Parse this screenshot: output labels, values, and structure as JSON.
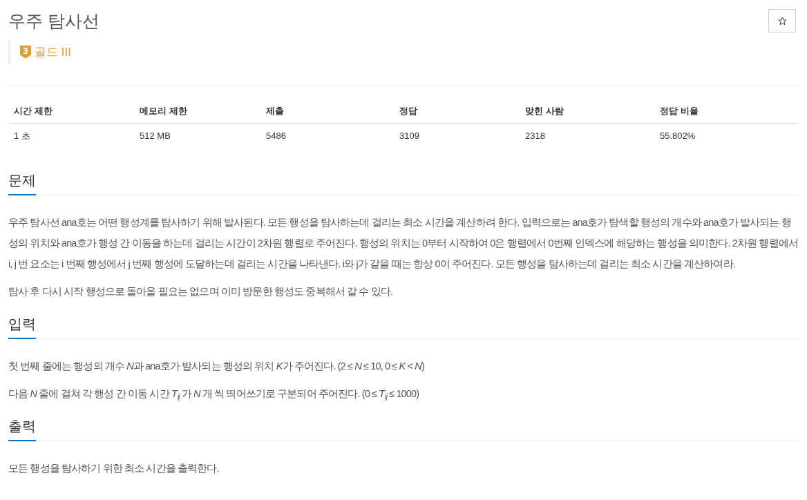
{
  "title": "우주 탐사선",
  "favorite_button": {
    "starred": false
  },
  "tier": {
    "number": "3",
    "label": "골드 III"
  },
  "stats": {
    "columns": [
      "시간 제한",
      "메모리 제한",
      "제출",
      "정답",
      "맞힌 사람",
      "정답 비율"
    ],
    "rows": [
      [
        "1 초",
        "512 MB",
        "5486",
        "3109",
        "2318",
        "55.802%"
      ]
    ]
  },
  "sections": [
    {
      "heading": "문제",
      "paragraphs": [
        [
          {
            "kind": "text",
            "text": "우주 탐사선 ana호는 어떤 행성계를 탐사하기 위해 발사된다. 모든 행성을 탐사하는데 걸리는 최소 시간을 계산하려 한다. 입력으로는 ana호가 탐색할 행성의 개수와 ana호가 발사되는 행성의 위치와 ana호가 행성 간 이동을 하는데 걸리는 시간이 2차원 행렬로 주어진다. 행성의 위치는 0부터 시작하여 0은 행렬에서 0번째 인덱스에 해당하는 행성을 의미한다. 2차원 행렬에서 i, j 번 요소는 i 번째 행성에서 j 번째 행성에 도달하는데 걸리는 시간을 나타낸다. i와 j가 같을 때는 항상 0이 주어진다. 모든 행성을 탐사하는데 걸리는 최소 시간을 계산하여라."
          }
        ],
        [
          {
            "kind": "text",
            "text": "탐사 후 다시 시작 행성으로 돌아올 필요는 없으며 이미 방문한 행성도 중복해서 갈 수 있다."
          }
        ]
      ]
    },
    {
      "heading": "입력",
      "paragraphs": [
        [
          {
            "kind": "text",
            "text": "첫 번째 줄에는 행성의 개수 "
          },
          {
            "kind": "var",
            "text": "N"
          },
          {
            "kind": "text",
            "text": "과 ana호가 발사되는 행성의 위치 "
          },
          {
            "kind": "var",
            "text": "K"
          },
          {
            "kind": "text",
            "text": "가 주어진다. (2 ≤ "
          },
          {
            "kind": "var",
            "text": "N"
          },
          {
            "kind": "text",
            "text": " ≤ 10, 0 ≤ "
          },
          {
            "kind": "var",
            "text": "K"
          },
          {
            "kind": "text",
            "text": " < "
          },
          {
            "kind": "var",
            "text": "N"
          },
          {
            "kind": "text",
            "text": ")"
          }
        ],
        [
          {
            "kind": "text",
            "text": "다음 "
          },
          {
            "kind": "var",
            "text": "N"
          },
          {
            "kind": "text",
            "text": " 줄에 걸쳐 각 행성 간 이동 시간 "
          },
          {
            "kind": "var",
            "text": "T"
          },
          {
            "kind": "sub",
            "text": "ij"
          },
          {
            "kind": "text",
            "text": " 가 "
          },
          {
            "kind": "var",
            "text": "N"
          },
          {
            "kind": "text",
            "text": " 개 씩 띄어쓰기로 구분되어 주어진다. (0 ≤ "
          },
          {
            "kind": "var",
            "text": "T"
          },
          {
            "kind": "sub",
            "text": "ij"
          },
          {
            "kind": "text",
            "text": "  ≤ 1000)"
          }
        ]
      ]
    },
    {
      "heading": "출력",
      "paragraphs": [
        [
          {
            "kind": "text",
            "text": "모든 행성을 탐사하기 위한 최소 시간을 출력한다."
          }
        ]
      ]
    }
  ]
}
